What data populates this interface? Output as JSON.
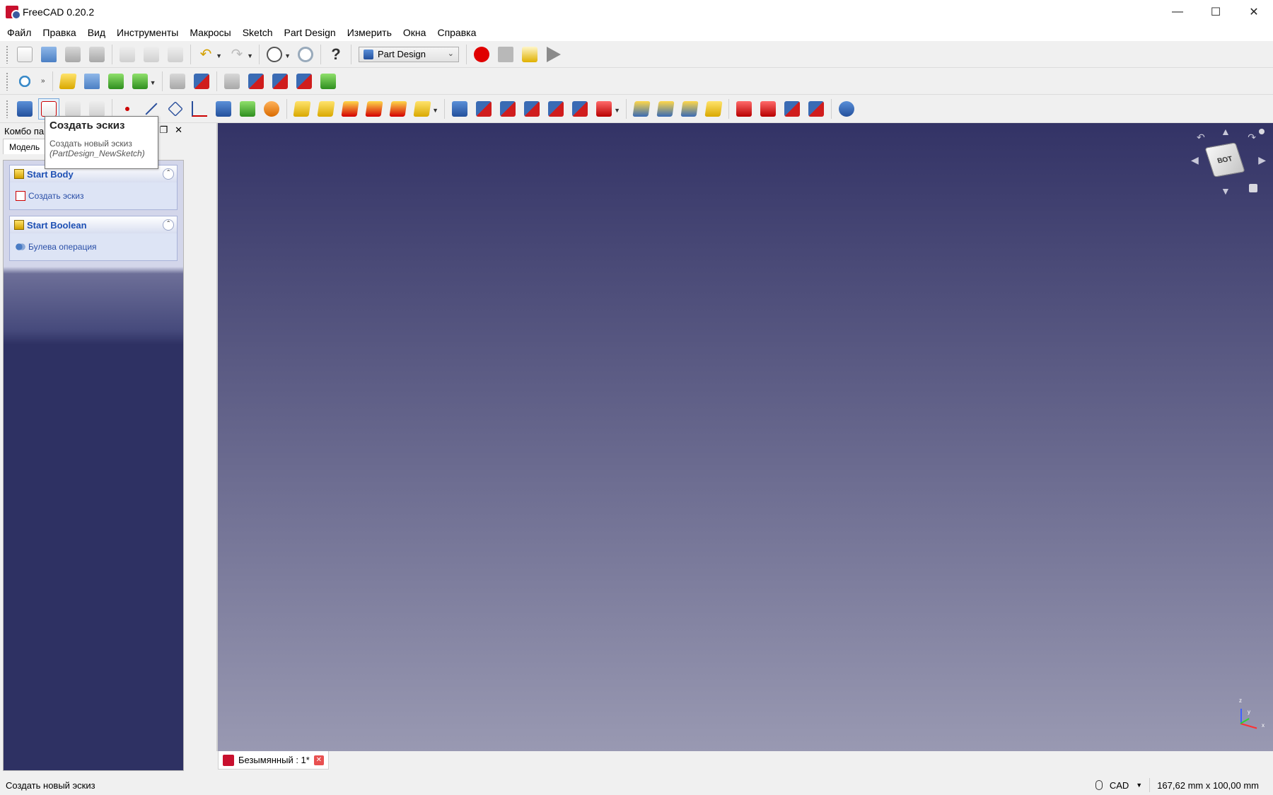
{
  "window": {
    "title": "FreeCAD 0.20.2"
  },
  "menu": [
    "Файл",
    "Правка",
    "Вид",
    "Инструменты",
    "Макросы",
    "Sketch",
    "Part Design",
    "Измерить",
    "Окна",
    "Справка"
  ],
  "workbench": {
    "selected": "Part Design"
  },
  "combo_panel": {
    "title": "Комбо па",
    "tab": "Модель"
  },
  "task_boxes": [
    {
      "title": "Start Body",
      "action": "Создать эскиз"
    },
    {
      "title": "Start Boolean",
      "action": "Булева операция"
    }
  ],
  "tooltip": {
    "title": "Создать эскиз",
    "description": "Создать новый эскиз",
    "command": "(PartDesign_NewSketch)"
  },
  "document_tab": {
    "label": "Безымянный : 1*"
  },
  "status": {
    "message": "Создать новый эскиз",
    "nav_style": "CAD",
    "dimensions": "167,62 mm x 100,00 mm"
  },
  "navcube": {
    "face_label": "ВОТ"
  },
  "axes": {
    "x": "x",
    "y": "y",
    "z": "z"
  },
  "icons": {
    "window_controls": [
      "minimize-icon",
      "maximize-icon",
      "close-icon"
    ],
    "colors": {
      "viewport_top": "#333366",
      "viewport_bottom": "#9999b2",
      "link_blue": "#1e50b4",
      "record_red": "#e00000"
    }
  }
}
